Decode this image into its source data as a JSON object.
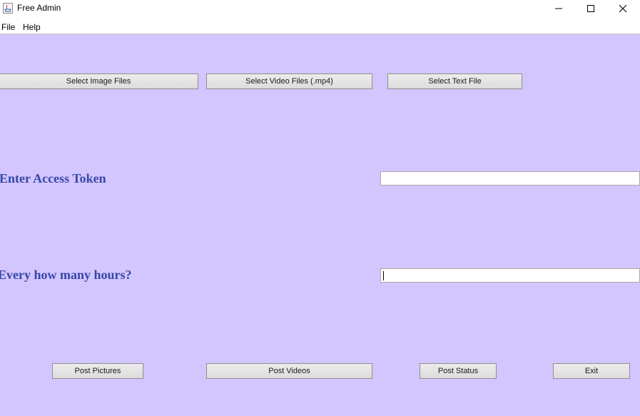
{
  "window": {
    "title": "Free Admin",
    "icons": {
      "app": "java-app-icon",
      "minimize": "minimize-icon",
      "maximize": "maximize-icon",
      "close": "close-icon"
    }
  },
  "menubar": {
    "items": [
      {
        "label": "File"
      },
      {
        "label": "Help"
      }
    ]
  },
  "file_buttons": {
    "select_images": "Select Image Files",
    "select_videos": "Select Video Files (.mp4)",
    "select_text": "Select Text File"
  },
  "form": {
    "access_token_label": "Enter Access Token",
    "access_token_value": "",
    "hours_label": "Every how many hours?",
    "hours_value": ""
  },
  "action_buttons": {
    "post_pictures": "Post Pictures",
    "post_videos": "Post Videos",
    "post_status": "Post Status",
    "exit": "Exit"
  },
  "colors": {
    "content_background": "#d3c5fd",
    "label_text": "#3648a8"
  }
}
